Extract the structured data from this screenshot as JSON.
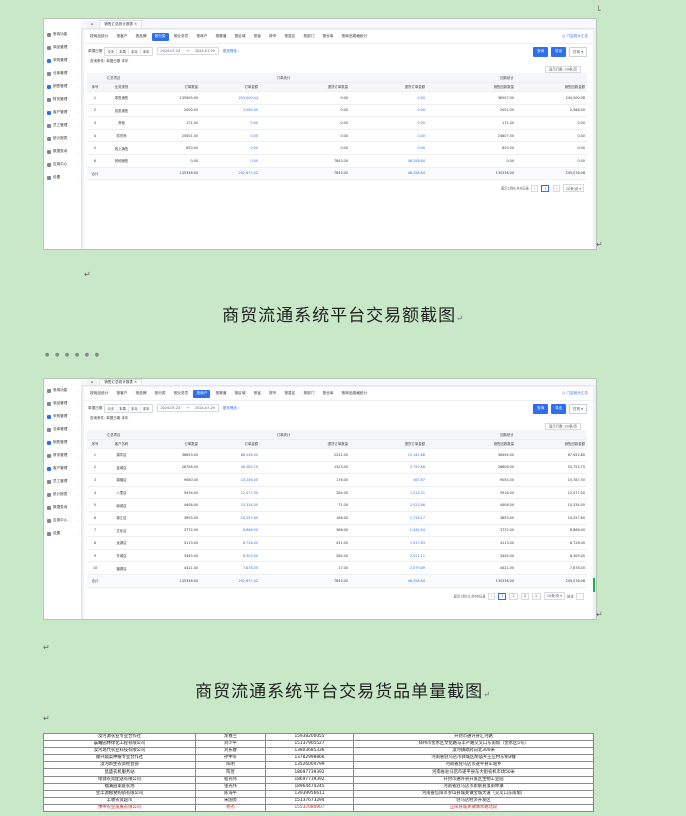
{
  "nav_items": [
    "按商品统计",
    "按客户统计",
    "按品牌统计",
    "按分类统计",
    "按业务员统计",
    "按渠道统计",
    "按商户统计",
    "按区域统计",
    "按省统计",
    "按市统计",
    "按县区统计",
    "按部门统计"
  ],
  "shot1": {
    "window_tab": "销售汇总统计报表",
    "sidebar": [
      "常用功能",
      "商品管理",
      "采购管理",
      "仓库管理",
      "销售管理",
      "财务管理",
      "客户管理",
      "员工管理",
      "统计报表",
      "数据查询",
      "应用中心",
      "设置"
    ],
    "nav": [
      "按商品统计",
      "按客户",
      "按品牌",
      "按分类",
      "按业务员",
      "按商户",
      "按渠道",
      "按区域",
      "按省",
      "按市",
      "按县区",
      "按部门",
      "按仓库",
      "按商品规格统计"
    ],
    "active_nav": 3,
    "right_link": "门店统计汇总",
    "filter_label": "单据日期",
    "seg": [
      "今天",
      "本周",
      "本月",
      "本年"
    ],
    "date_from": "2024-07-23",
    "date_to": "2024-07-29",
    "more": "更多筛选",
    "btn_search": "查询",
    "btn_export": "导出",
    "btn_print": "打印",
    "query_info": "查询条件: 单据日期 本年",
    "row_config": "显示行数: 20条/页",
    "groups": [
      "汇总项目",
      "订单统计",
      "回款统计"
    ],
    "headers": [
      "序号",
      "业务类别",
      "订单数量",
      "订单金额",
      "退货订单数量",
      "退货订单金额",
      "销售回款数量",
      "销售回款金额"
    ],
    "rows": [
      [
        "1",
        "零售销售",
        "135905.00",
        "253,000.44",
        "0.00",
        "0.00",
        "36507.00",
        "244,000.38"
      ],
      [
        "2",
        "批发销售",
        "2000.00",
        "2,560.00",
        "0.00",
        "0.00",
        "2001.00",
        "2,586.00"
      ],
      [
        "3",
        "其他",
        "171.00",
        "0.00",
        "0.00",
        "0.00",
        "171.00",
        "0.00"
      ],
      [
        "4",
        "供货商",
        "25001.00",
        "0.00",
        "0.00",
        "0.00",
        "24807.00",
        "0.00"
      ],
      [
        "5",
        "线上销售",
        "820.00",
        "0.00",
        "0.00",
        "0.00",
        "820.00",
        "0.00"
      ],
      [
        "6",
        "其他销售",
        "0.00",
        "0.00",
        "7843.00",
        "46,358.84",
        "0.00",
        "0.00"
      ]
    ],
    "total": [
      "合计",
      "",
      "135338.00",
      "252,877.42",
      "7843.00",
      "46,358.84",
      "135338.00",
      "245,078.08"
    ],
    "pager": "显示1到6,共6记录",
    "pager_page": "1",
    "pager_size": "20条/页"
  },
  "caption1": "商贸流通系统平台交易额截图",
  "shot2": {
    "window_tab": "销售汇总统计报表",
    "sidebar": [
      "常用功能",
      "商品管理",
      "采购管理",
      "仓库管理",
      "销售管理",
      "财务管理",
      "客户管理",
      "员工管理",
      "统计报表",
      "数据查询",
      "应用中心",
      "设置"
    ],
    "nav": [
      "按商品统计",
      "按客户",
      "按品牌",
      "按分类",
      "按业务员",
      "按商户",
      "按渠道",
      "按区域",
      "按省",
      "按市",
      "按县区",
      "按部门",
      "按仓库",
      "按商品规格统计"
    ],
    "active_nav": 5,
    "right_link": "门店统计汇总",
    "filter_label": "单据日期",
    "seg": [
      "今天",
      "本周",
      "本月",
      "本年"
    ],
    "date_from": "2024-07-23",
    "date_to": "2024-07-29",
    "more": "更多筛选",
    "btn_search": "查询",
    "btn_export": "导出",
    "btn_print": "打印",
    "query_info": "查询条件: 单据日期 本年",
    "row_config": "显示行数: 20条/页",
    "groups": [
      "汇总项目",
      "订单统计",
      "回款统计"
    ],
    "headers": [
      "序号",
      "客户名称",
      "订单数量",
      "订单金额",
      "退货订单数量",
      "退货订单金额",
      "销售回款数量",
      "销售回款金额"
    ],
    "rows": [
      [
        "1",
        "锦华店",
        "36653.00",
        "68,246.00",
        "2251.00",
        "15,141.86",
        "36494.00",
        "67,452.80"
      ],
      [
        "2",
        "金城店",
        "26756.00",
        "56,282.79",
        "1323.00",
        "5,790.68",
        "26606.00",
        "53,753.75"
      ],
      [
        "3",
        "锦福店",
        "9080.00",
        "15,246.00",
        "176.00",
        "367.67",
        "9054.00",
        "15,787.50"
      ],
      [
        "4",
        "八里店",
        "5916.00",
        "12,477.00",
        "284.00",
        "1,214.31",
        "5916.00",
        "12,477.00"
      ],
      [
        "5",
        "南城店",
        "4408.00",
        "10,334.00",
        "71.00",
        "2,523.46",
        "4408.00",
        "10,334.00"
      ],
      [
        "6",
        "锦江店",
        "3893.00",
        "10,257.60",
        "168.00",
        "1,718.17",
        "3893.00",
        "10,257.60"
      ],
      [
        "7",
        "文化店",
        "3772.00",
        "8,866.00",
        "366.00",
        "1,444.54",
        "3772.00",
        "8,866.00"
      ],
      [
        "8",
        "龙湖店",
        "4113.00",
        "8,728.00",
        "431.00",
        "1,917.63",
        "4113.00",
        "8,728.00"
      ],
      [
        "9",
        "东城店",
        "3445.00",
        "8,305.00",
        "284.00",
        "2,021.11",
        "3445.00",
        "8,305.00"
      ],
      [
        "10",
        "福源店",
        "4421.00",
        "7,878.00",
        "17.00",
        "2,079.89",
        "4421.00",
        "7,878.00"
      ]
    ],
    "total": [
      "合计",
      "",
      "135338.00",
      "252,877.42",
      "7843.00",
      "46,358.84",
      "135338.00",
      "245,078.08"
    ],
    "pager": "显示1到10,共66记录",
    "pager_pages": [
      "1",
      "2",
      "3",
      ">"
    ],
    "pager_size": "10条/页",
    "pager_goto": "前往"
  },
  "caption2": "商贸流通系统平台交易货品单量截图",
  "contacts": [
    [
      "汝河源农业专业合作社",
      "龙春兰",
      "15938200055",
      "开封市通许县汇河路"
    ],
    [
      "晨曦园林绿化工程有限公司",
      "刘少平",
      "15137905527",
      "郑州市金水区文化路与丰产路交叉口东南角（金水区5号）"
    ],
    [
      "汝河现代农业科技有限公司",
      "刘长春",
      "13803685336",
      "汝河镇政府向北300米"
    ],
    [
      "顺兴蔬菜种植专业合作社",
      "孙中军",
      "13782998866",
      "河南省驻马店市驿城区胡庙乡王庄村东侧3幢"
    ],
    [
      "汝河新生农资经营部",
      "陈明",
      "13526004799",
      "河南省驻马店市遂平县车站乡"
    ],
    [
      "昌盛农机服务站",
      "陈宣",
      "18697739392",
      "河南省驻马店市遂平县东大街农机市场50米"
    ],
    [
      "绿源农资配送有限公司",
      "程光伟",
      "18697739392",
      "开封市通许县开发区生物工业园"
    ],
    [
      "福满园家庭农场",
      "张光伟",
      "18964474245",
      "河南省驻马店市新蔡县汝南埠镇"
    ],
    [
      "金丰源粮食购销有限公司",
      "陈海平",
      "13939956611",
      "河南省信阳市罗山县城关镇宝城大道（交叉口东南角）"
    ],
    [
      "丰收农资超市",
      "宋国亮",
      "15137673294",
      "驻马店经济开发区"
    ],
    [
      "豫中农业发展有限公司",
      "杨杰",
      "15537080907",
      "正阳县城关镇慎水路北段"
    ]
  ],
  "contacts_highlight": 10
}
